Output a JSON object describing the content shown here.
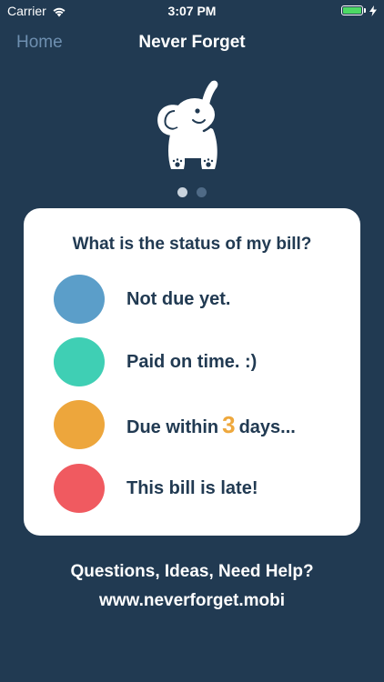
{
  "status_bar": {
    "carrier": "Carrier",
    "time": "3:07 PM",
    "battery_level": 1.0,
    "icons": [
      "wifi-icon",
      "battery-icon",
      "charging-bolt-icon"
    ]
  },
  "nav": {
    "back_label": "Home",
    "title": "Never Forget"
  },
  "mascot": {
    "icon": "elephant-icon"
  },
  "pager": {
    "page_count": 2,
    "current_page": 1
  },
  "card": {
    "title": "What is the status of my bill?",
    "items": [
      {
        "label": "Not due yet.",
        "color": "#5b9ec9"
      },
      {
        "label": "Paid on time. :)",
        "color": "#3fcfb4"
      },
      {
        "label_prefix": "Due within",
        "days": "3",
        "label_suffix": "days...",
        "color": "#eda63c"
      },
      {
        "label": "This bill is late!",
        "color": "#f05a60"
      }
    ]
  },
  "footer": {
    "question": "Questions, Ideas, Need Help?",
    "link": "www.neverforget.mobi"
  },
  "colors": {
    "background": "#213a52",
    "card": "#ffffff",
    "text_dark": "#213a52",
    "nav_back": "#6e8fb0",
    "highlight": "#eea83d"
  }
}
